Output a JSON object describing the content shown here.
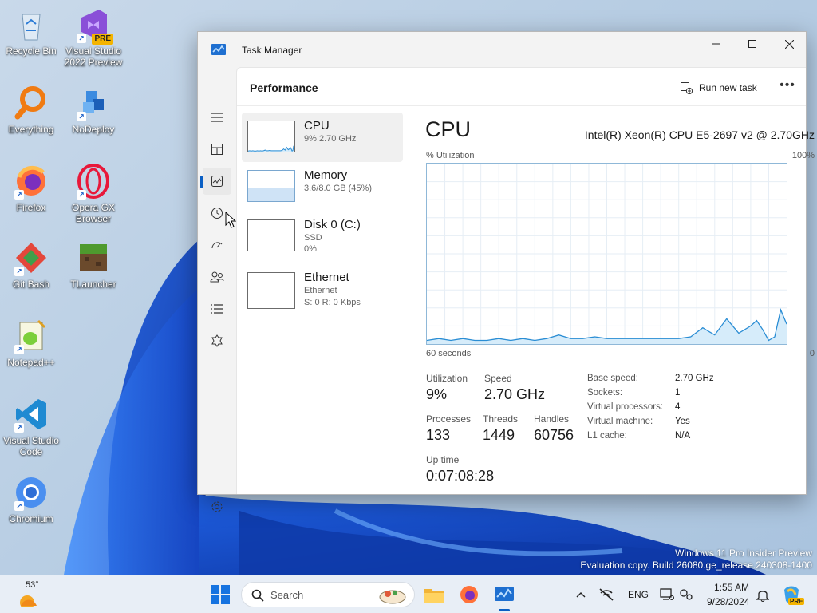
{
  "desktop": {
    "icons": [
      {
        "label": "Recycle Bin"
      },
      {
        "label": "Visual Studio 2022 Preview",
        "badge": "PRE"
      },
      {
        "label": "Everything"
      },
      {
        "label": "NoDeploy"
      },
      {
        "label": "Firefox"
      },
      {
        "label": "Opera GX Browser"
      },
      {
        "label": "Git Bash"
      },
      {
        "label": "TLauncher"
      },
      {
        "label": "Notepad++"
      },
      {
        "label": "Visual Studio Code"
      },
      {
        "label": "Chromium"
      }
    ],
    "watermark": {
      "line1": "Windows 11 Pro Insider Preview",
      "line2": "Evaluation copy. Build 26080.ge_release.240308-1400"
    }
  },
  "window": {
    "title": "Task Manager",
    "header_title": "Performance",
    "run_new_task": "Run new task",
    "more": "•••",
    "nav_icons": [
      "menu-icon",
      "processes-icon",
      "performance-icon",
      "app-history-icon",
      "startup-apps-icon",
      "users-icon",
      "details-icon",
      "services-icon",
      "settings-icon"
    ],
    "resources": [
      {
        "name": "CPU",
        "sub1": "9% 2.70 GHz",
        "sub2": ""
      },
      {
        "name": "Memory",
        "sub1": "3.6/8.0 GB (45%)",
        "sub2": ""
      },
      {
        "name": "Disk 0 (C:)",
        "sub1": "SSD",
        "sub2": "0%"
      },
      {
        "name": "Ethernet",
        "sub1": "Ethernet",
        "sub2": "S: 0 R: 0 Kbps"
      }
    ],
    "memory_fill": 0.45,
    "detail": {
      "title": "CPU",
      "model": "Intel(R) Xeon(R) CPU E5-2697 v2 @ 2.70GHz",
      "util_label": "% Utilization",
      "max_label": "100%",
      "time_left": "60 seconds",
      "time_right": "0",
      "stats": {
        "utilization_label": "Utilization",
        "utilization": "9%",
        "speed_label": "Speed",
        "speed": "2.70 GHz",
        "processes_label": "Processes",
        "processes": "133",
        "threads_label": "Threads",
        "threads": "1449",
        "handles_label": "Handles",
        "handles": "60756",
        "uptime_label": "Up time",
        "uptime": "0:07:08:28"
      },
      "specs": [
        {
          "k": "Base speed:",
          "v": "2.70 GHz"
        },
        {
          "k": "Sockets:",
          "v": "1"
        },
        {
          "k": "Virtual processors:",
          "v": "4"
        },
        {
          "k": "Virtual machine:",
          "v": "Yes"
        },
        {
          "k": "L1 cache:",
          "v": "N/A"
        }
      ]
    }
  },
  "chart_data": {
    "type": "area",
    "title": "",
    "xlabel": "",
    "ylabel": "% Utilization",
    "xlim": [
      60,
      0
    ],
    "ylim": [
      0,
      100
    ],
    "x": [
      60,
      58,
      56,
      54,
      52,
      50,
      48,
      46,
      44,
      42,
      40,
      38,
      36,
      34,
      32,
      30,
      28,
      26,
      24,
      22,
      20,
      18,
      16,
      14,
      12,
      10,
      8,
      6,
      5,
      4,
      3,
      2,
      1,
      0
    ],
    "values": [
      2,
      3,
      2,
      3,
      2,
      2,
      3,
      2,
      3,
      2,
      3,
      5,
      3,
      3,
      4,
      3,
      3,
      3,
      3,
      3,
      3,
      3,
      4,
      9,
      5,
      14,
      6,
      10,
      13,
      8,
      2,
      4,
      19,
      11
    ]
  },
  "taskbar": {
    "weather_temp": "53°",
    "search_label": "Search",
    "lang": "ENG",
    "time": "1:55 AM",
    "date": "9/28/2024",
    "copilot_badge": "PRE"
  }
}
